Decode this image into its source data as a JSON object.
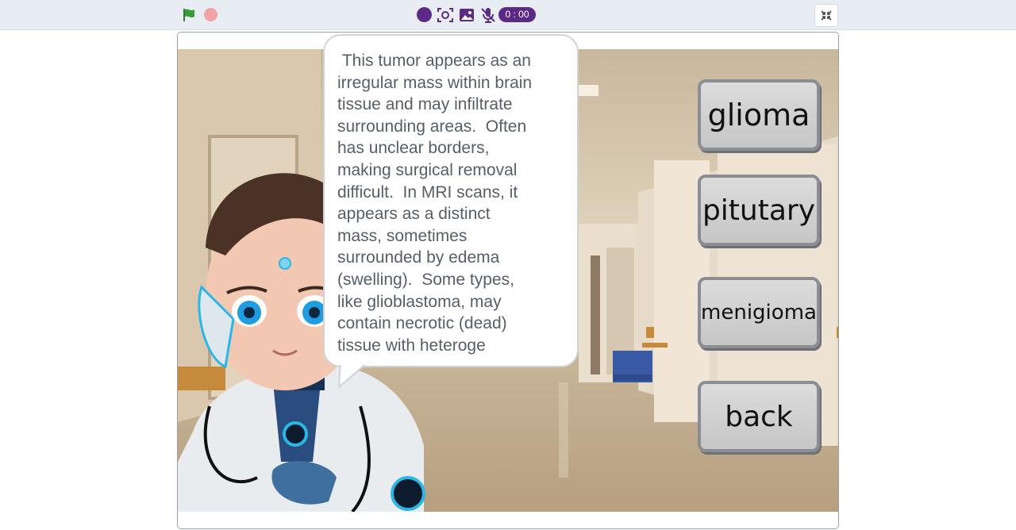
{
  "toolbar": {
    "timer": "0 : 00",
    "icons": [
      "green-flag-icon",
      "stop-icon",
      "record-icon",
      "screenshot-icon",
      "image-icon",
      "microphone-icon",
      "fullscreen-exit-icon"
    ],
    "colors": {
      "flag": "#3a9a3a",
      "stop": "#f2a3a8",
      "record": "#5b2a86"
    }
  },
  "stage": {
    "speech": " This tumor appears as an\nirregular mass within brain\ntissue and may infiltrate\nsurrounding areas.  Often\nhas unclear borders,\nmaking surgical removal\ndifficult.  In MRI scans, it\nappears as a distinct\nmass, sometimes\nsurrounded by edema\n(swelling).  Some types,\nlike glioblastoma, may\ncontain necrotic (dead)\ntissue with heteroge",
    "buttons": {
      "glioma": "glioma",
      "pitutary": "pitutary",
      "menigioma": "menigioma",
      "back": "back"
    }
  }
}
